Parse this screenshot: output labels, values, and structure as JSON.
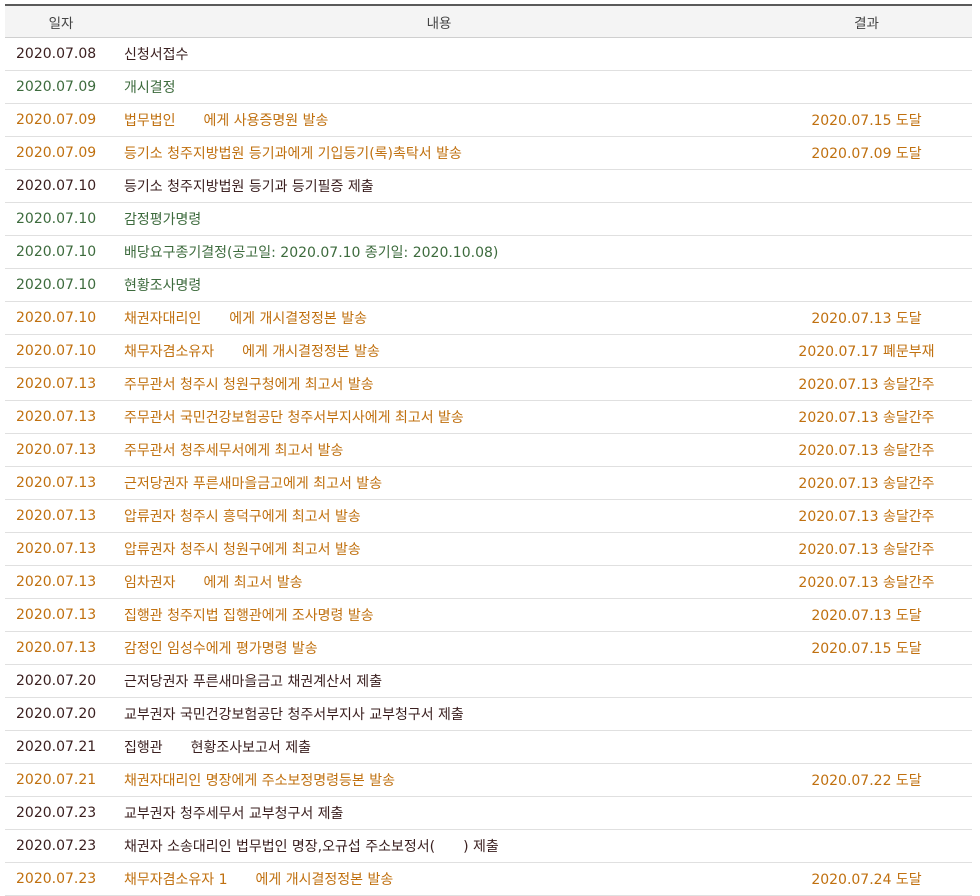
{
  "header": {
    "date": "일자",
    "content": "내용",
    "result": "결과"
  },
  "colors": {
    "black": "#3a1f1f",
    "green": "#3d6b3d",
    "orange": "#c0700f"
  },
  "rows": [
    {
      "type": "black",
      "date": "2020.07.08",
      "c1": "신청서접수",
      "c2": "",
      "result": ""
    },
    {
      "type": "green",
      "date": "2020.07.09",
      "c1": "개시결정",
      "c2": "",
      "result": ""
    },
    {
      "type": "orange",
      "date": "2020.07.09",
      "c1": "법무법인",
      "c2": "에게 사용증명원 발송",
      "result": "2020.07.15 도달"
    },
    {
      "type": "orange",
      "date": "2020.07.09",
      "c1": "등기소 청주지방법원 등기과에게 기입등기(록)촉탁서 발송",
      "c2": "",
      "result": "2020.07.09 도달"
    },
    {
      "type": "black",
      "date": "2020.07.10",
      "c1": "등기소 청주지방법원 등기과 등기필증 제출",
      "c2": "",
      "result": ""
    },
    {
      "type": "green",
      "date": "2020.07.10",
      "c1": "감정평가명령",
      "c2": "",
      "result": ""
    },
    {
      "type": "green",
      "date": "2020.07.10",
      "c1": "배당요구종기결정(공고일: 2020.07.10 종기일: 2020.10.08)",
      "c2": "",
      "result": ""
    },
    {
      "type": "green",
      "date": "2020.07.10",
      "c1": "현황조사명령",
      "c2": "",
      "result": ""
    },
    {
      "type": "orange",
      "date": "2020.07.10",
      "c1": "채권자대리인",
      "c2": "에게 개시결정정본 발송",
      "result": "2020.07.13 도달"
    },
    {
      "type": "orange",
      "date": "2020.07.10",
      "c1": "채무자겸소유자",
      "c2": "에게 개시결정정본 발송",
      "result": "2020.07.17 폐문부재"
    },
    {
      "type": "orange",
      "date": "2020.07.13",
      "c1": "주무관서 청주시 청원구청에게 최고서 발송",
      "c2": "",
      "result": "2020.07.13 송달간주"
    },
    {
      "type": "orange",
      "date": "2020.07.13",
      "c1": "주무관서 국민건강보험공단 청주서부지사에게 최고서 발송",
      "c2": "",
      "result": "2020.07.13 송달간주"
    },
    {
      "type": "orange",
      "date": "2020.07.13",
      "c1": "주무관서 청주세무서에게 최고서 발송",
      "c2": "",
      "result": "2020.07.13 송달간주"
    },
    {
      "type": "orange",
      "date": "2020.07.13",
      "c1": "근저당권자 푸른새마을금고에게 최고서 발송",
      "c2": "",
      "result": "2020.07.13 송달간주"
    },
    {
      "type": "orange",
      "date": "2020.07.13",
      "c1": "압류권자 청주시 흥덕구에게 최고서 발송",
      "c2": "",
      "result": "2020.07.13 송달간주"
    },
    {
      "type": "orange",
      "date": "2020.07.13",
      "c1": "압류권자 청주시 청원구에게 최고서 발송",
      "c2": "",
      "result": "2020.07.13 송달간주"
    },
    {
      "type": "orange",
      "date": "2020.07.13",
      "c1": "임차권자",
      "c2": "에게 최고서 발송",
      "result": "2020.07.13 송달간주"
    },
    {
      "type": "orange",
      "date": "2020.07.13",
      "c1": "집행관 청주지법 집행관에게 조사명령 발송",
      "c2": "",
      "result": "2020.07.13 도달"
    },
    {
      "type": "orange",
      "date": "2020.07.13",
      "c1": "감정인 임성수에게 평가명령 발송",
      "c2": "",
      "result": "2020.07.15 도달"
    },
    {
      "type": "black",
      "date": "2020.07.20",
      "c1": "근저당권자 푸른새마을금고 채권계산서 제출",
      "c2": "",
      "result": ""
    },
    {
      "type": "black",
      "date": "2020.07.20",
      "c1": "교부권자 국민건강보험공단 청주서부지사 교부청구서 제출",
      "c2": "",
      "result": ""
    },
    {
      "type": "black",
      "date": "2020.07.21",
      "c1": "집행관",
      "c2": "현황조사보고서 제출",
      "result": ""
    },
    {
      "type": "orange",
      "date": "2020.07.21",
      "c1": "채권자대리인 명장에게 주소보정명령등본 발송",
      "c2": "",
      "result": "2020.07.22 도달"
    },
    {
      "type": "black",
      "date": "2020.07.23",
      "c1": "교부권자 청주세무서 교부청구서 제출",
      "c2": "",
      "result": ""
    },
    {
      "type": "black",
      "date": "2020.07.23",
      "c1": "채권자 소송대리인 법무법인 명장,오규섭 주소보정서(",
      "c2": ") 제출",
      "result": ""
    },
    {
      "type": "orange",
      "date": "2020.07.23",
      "c1": "채무자겸소유자 1",
      "c2": "에게 개시결정정본 발송",
      "result": "2020.07.24 도달"
    }
  ]
}
